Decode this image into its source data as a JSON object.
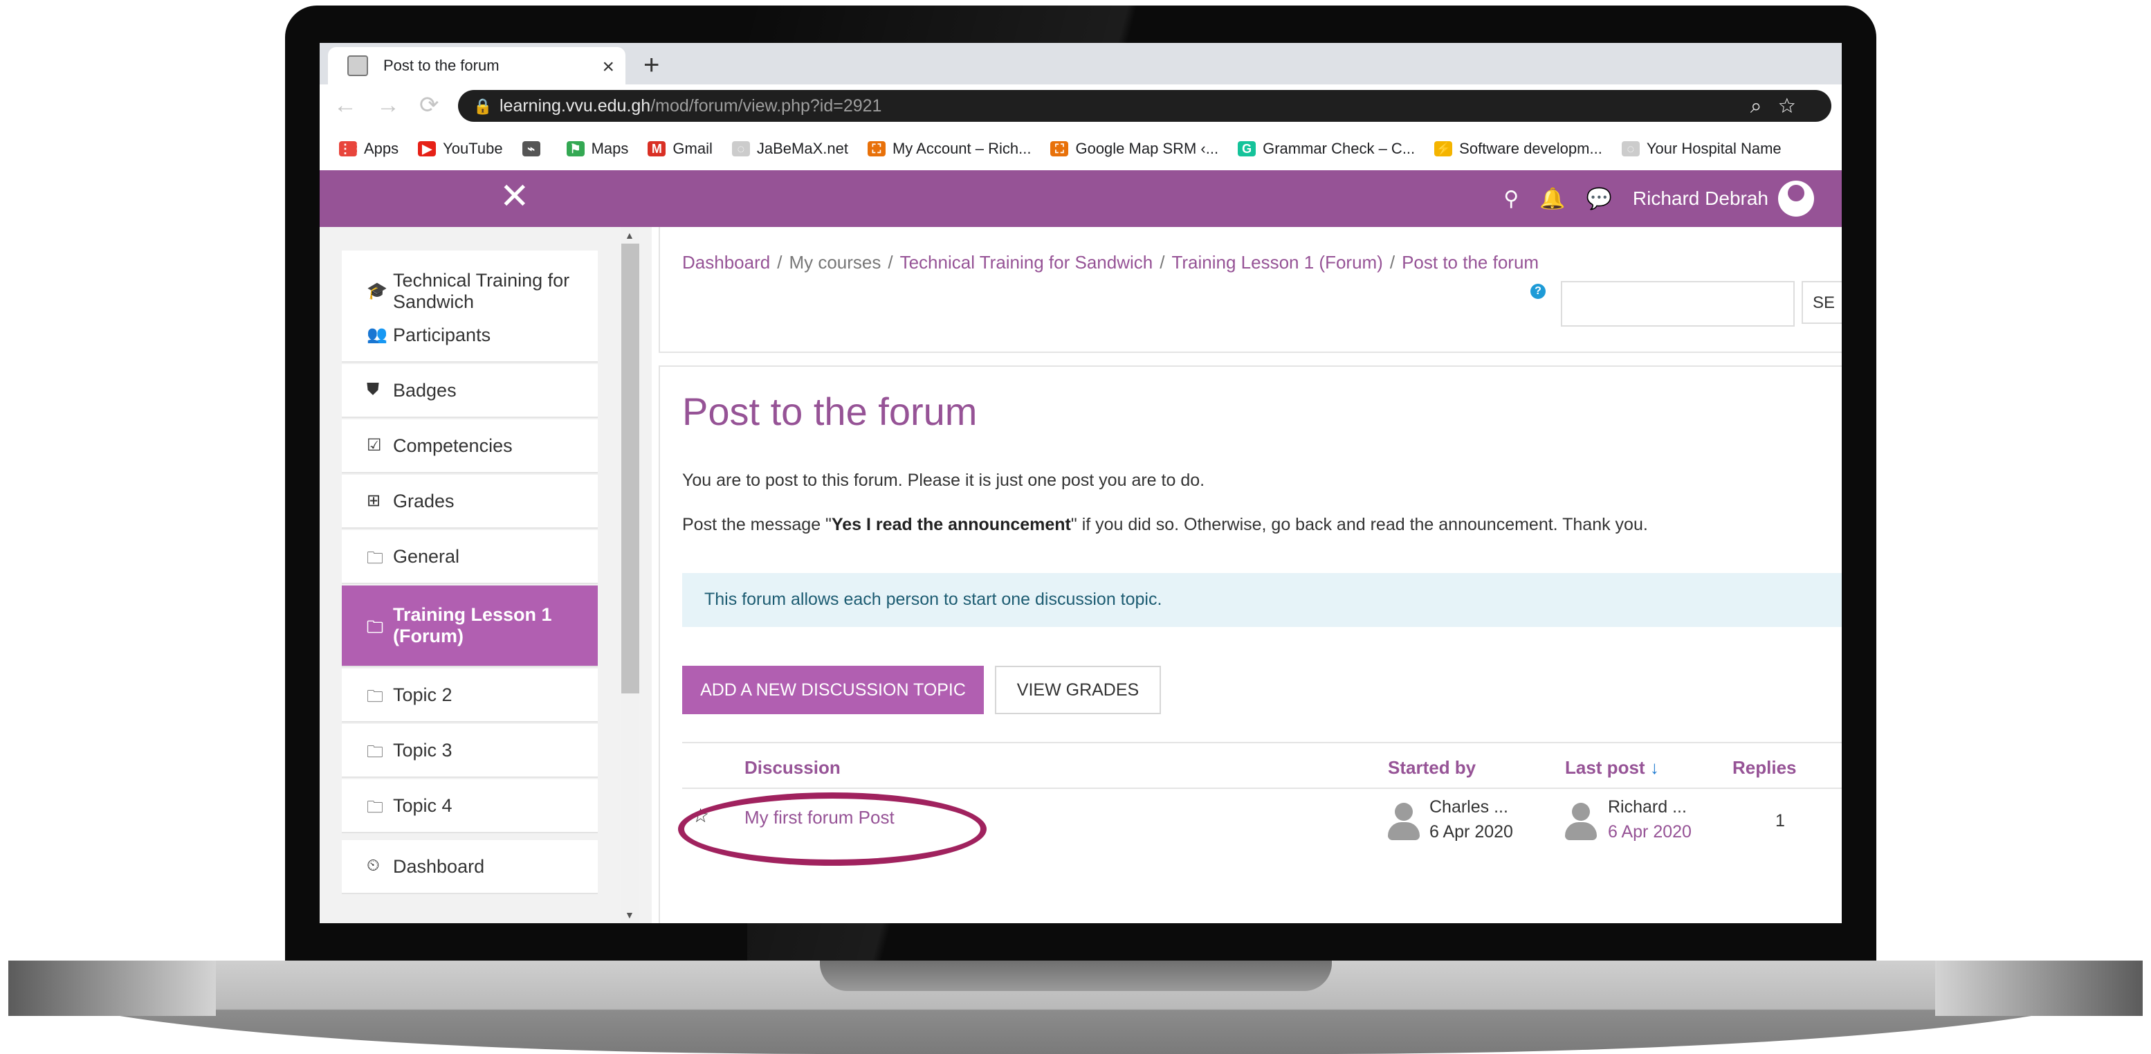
{
  "browser": {
    "tab_title": "Post to the forum",
    "tab_close": "×",
    "new_tab": "+",
    "url_domain": "learning.vvu.edu.gh",
    "url_path": "/mod/forum/view.php?id=2921",
    "bookmarks": [
      {
        "label": "Apps",
        "icon": "apps-grid-icon",
        "color": "#e8453c"
      },
      {
        "label": "YouTube",
        "icon": "youtube-icon",
        "color": "#e62117"
      },
      {
        "label": "",
        "icon": "bookmark-icon",
        "color": "#555555"
      },
      {
        "label": "Maps",
        "icon": "maps-icon",
        "color": "#34a853"
      },
      {
        "label": "Gmail",
        "icon": "gmail-icon",
        "color": "#d93025"
      },
      {
        "label": "JaBeMaX.net",
        "icon": "globe-icon",
        "color": "#cccccc"
      },
      {
        "label": "My Account – Rich...",
        "icon": "account-icon",
        "color": "#e8710a"
      },
      {
        "label": "Google Map SRM ‹...",
        "icon": "map-icon",
        "color": "#e8710a"
      },
      {
        "label": "Grammar Check – C...",
        "icon": "grammarly-icon",
        "color": "#15c39a"
      },
      {
        "label": "Software developm...",
        "icon": "lightning-icon",
        "color": "#f4b400"
      },
      {
        "label": "Your Hospital Name",
        "icon": "globe-icon",
        "color": "#cccccc"
      }
    ]
  },
  "navbar": {
    "close": "✕",
    "user_name": "Richard Debrah",
    "brand_color": "#965396"
  },
  "drawer": {
    "items": [
      {
        "label": "Technical Training for Sandwich",
        "icon": "graduation-cap-icon",
        "glyph": "🎓",
        "active": false
      },
      {
        "label": "Participants",
        "icon": "users-icon",
        "glyph": "👥",
        "active": false
      },
      {
        "label": "Badges",
        "icon": "shield-icon",
        "glyph": "⛊",
        "active": false
      },
      {
        "label": "Competencies",
        "icon": "check-square-icon",
        "glyph": "☑",
        "active": false
      },
      {
        "label": "Grades",
        "icon": "table-icon",
        "glyph": "⊞",
        "active": false
      },
      {
        "label": "General",
        "icon": "folder-icon",
        "glyph": "🗀",
        "active": false
      },
      {
        "label": "Training Lesson 1 (Forum)",
        "icon": "folder-icon",
        "glyph": "🗀",
        "active": true
      },
      {
        "label": "Topic 2",
        "icon": "folder-icon",
        "glyph": "🗀",
        "active": false
      },
      {
        "label": "Topic 3",
        "icon": "folder-icon",
        "glyph": "🗀",
        "active": false
      },
      {
        "label": "Topic 4",
        "icon": "folder-icon",
        "glyph": "🗀",
        "active": false
      },
      {
        "label": "Dashboard",
        "icon": "dashboard-icon",
        "glyph": "⏲",
        "active": false
      }
    ]
  },
  "breadcrumb": [
    "Dashboard",
    "My courses",
    "Technical Training for Sandwich",
    "Training Lesson 1 (Forum)",
    "Post to the forum"
  ],
  "search": {
    "button_label": "SE"
  },
  "main": {
    "title": "Post to the forum",
    "intro": "You are to post to this forum. Please it is just one post you are to do.",
    "message_prefix": "Post the message \"",
    "message_bold": "Yes I read the announcement",
    "message_suffix": "\" if you did so. Otherwise, go back and read the announcement. Thank you.",
    "alert": "This forum allows each person to start one discussion topic.",
    "add_button": "ADD A NEW DISCUSSION TOPIC",
    "grades_button": "VIEW GRADES"
  },
  "table": {
    "headers": {
      "discussion": "Discussion",
      "started_by": "Started by",
      "last_post": "Last post",
      "last_post_arrow": "↓",
      "replies": "Replies"
    },
    "rows": [
      {
        "star": "☆",
        "discussion": "My first forum Post",
        "started_by_name": "Charles ...",
        "started_by_date": "6 Apr 2020",
        "last_post_name": "Richard ...",
        "last_post_date": "6 Apr 2020",
        "replies": "1"
      }
    ]
  },
  "annotation": {
    "highlight_color": "#a0225e"
  }
}
